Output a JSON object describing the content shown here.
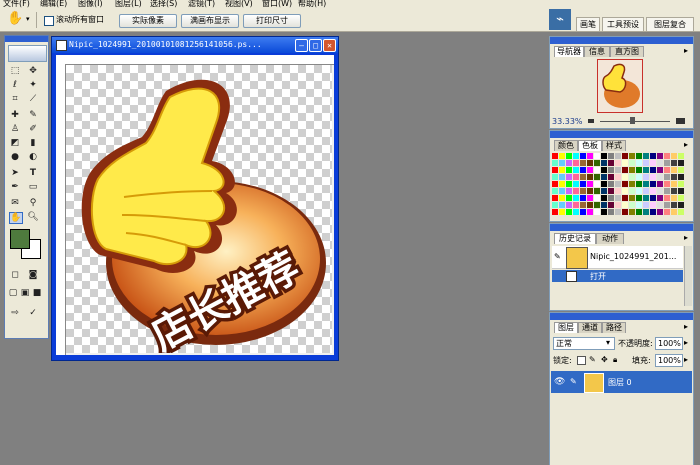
{
  "menu": [
    "文件(F)",
    "编辑(E)",
    "图像(I)",
    "图层(L)",
    "选择(S)",
    "滤镜(T)",
    "视图(V)",
    "窗口(W)",
    "帮助(H)"
  ],
  "options": {
    "scroll_all_label": "滚动所有窗口",
    "actual_pixels": "实际像素",
    "fit_screen": "满画布显示",
    "print_size": "打印尺寸"
  },
  "workspace_tabs": [
    "画笔",
    "工具预设",
    "图层复合"
  ],
  "document": {
    "title": "Nipic_1024991_20100101081256141056.ps...",
    "artwork_text": "店长推荐"
  },
  "navigator": {
    "tabs": [
      "导航器",
      "信息",
      "直方图"
    ],
    "zoom": "33.33%"
  },
  "color_panel": {
    "tabs": [
      "颜色",
      "色板",
      "样式"
    ],
    "colors": [
      "#ff0000",
      "#ffff00",
      "#00ff00",
      "#00ffff",
      "#0000ff",
      "#ff00ff",
      "#ffffff",
      "#000000",
      "#808080",
      "#c0c0c0",
      "#800000",
      "#808000",
      "#008000",
      "#008080",
      "#000080",
      "#800080",
      "#ff8080",
      "#ffcc66",
      "#ccff66",
      "#66ffcc",
      "#66ccff",
      "#cc66ff",
      "#ff6699",
      "#996633",
      "#663300",
      "#336600",
      "#003366",
      "#660033",
      "#ffcccc",
      "#ffffcc",
      "#ccffcc",
      "#ccffff",
      "#ccccff",
      "#ffccff",
      "#e0e0e0",
      "#a0a0a0",
      "#404040",
      "#202020"
    ]
  },
  "history": {
    "tabs": [
      "历史记录",
      "动作"
    ],
    "snapshot": "Nipic_1024991_201...",
    "items": [
      "打开"
    ]
  },
  "layers": {
    "tabs": [
      "图层",
      "通道",
      "路径"
    ],
    "blend_mode": "正常",
    "opacity_label": "不透明度:",
    "opacity": "100%",
    "lock_label": "锁定:",
    "fill_label": "填充:",
    "fill": "100%",
    "items": [
      {
        "name": "图层 0"
      }
    ]
  }
}
